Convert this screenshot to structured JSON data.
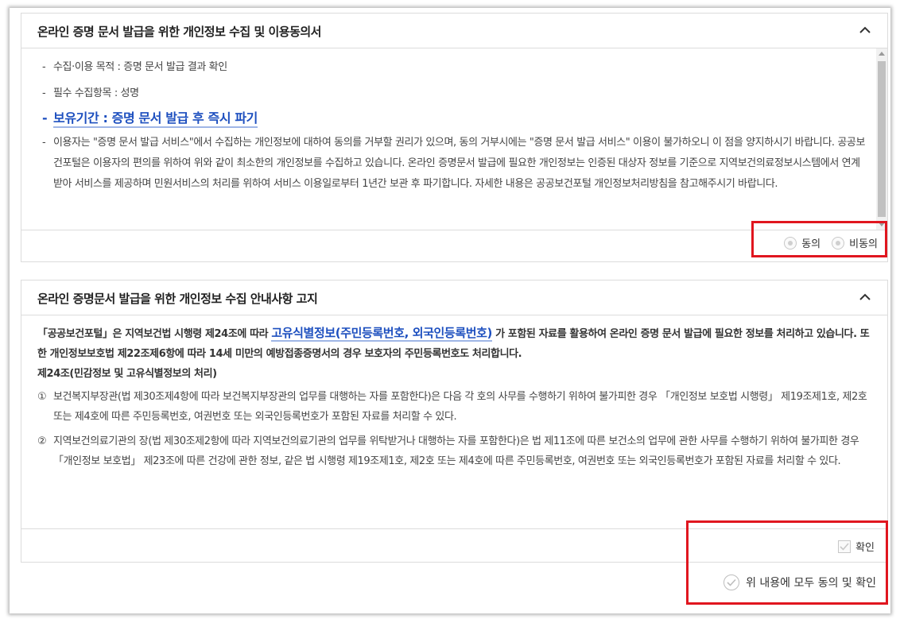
{
  "section1": {
    "title": "온라인 증명 문서 발급을 위한 개인정보 수집 및 이용동의서",
    "items": [
      "수집·이용 목적 : 증명 문서 발급 결과 확인",
      "필수 수집항목 : 성명",
      "보유기간 : 증명 문서 발급 후 즉시 파기",
      "이용자는 \"증명 문서 발급 서비스\"에서 수집하는 개인정보에 대하여 동의를 거부할 권리가 있으며, 동의 거부시에는 \"증명 문서 발급 서비스\" 이용이 불가하오니 이 점을 양지하시기 바랍니다. 공공보건포털은 이용자의 편의를 위하여 위와 같이 최소한의 개인정보를 수집하고 있습니다. 온라인 증명문서 발급에 필요한 개인정보는 인증된 대상자 정보를 기준으로 지역보건의료정보시스템에서 연계받아 서비스를 제공하며 민원서비스의 처리를 위하여 서비스 이용일로부터 1년간 보관 후 파기합니다. 자세한 내용은 공공보건포털 개인정보처리방침을 참고해주시기 바랍니다."
    ],
    "agree_label": "동의",
    "disagree_label": "비동의"
  },
  "section2": {
    "title": "온라인 증명문서 발급을 위한 개인정보 수집 안내사항 고지",
    "intro_before": "「공공보건포털」은 지역보건법 시행령 제24조에 따라",
    "intro_highlight": "고유식별정보(주민등록번호, 외국인등록번호)",
    "intro_after": "가 포함된 자료를 활용하여 온라인 증명 문서 발급에 필요한 정보를 처리하고 있습니다. 또한 개인정보보호법 제22조제6항에 따라 14세 미만의 예방접종증명서의 경우 보호자의 주민등록번호도 처리합니다.",
    "article_title": "제24조(민감정보 및 고유식별정보의 처리)",
    "items": [
      {
        "num": "①",
        "text": "보건복지부장관(법 제30조제4항에 따라 보건복지부장관의 업무를 대행하는 자를 포함한다)은 다음 각 호의 사무를 수행하기 위하여 불가피한 경우 「개인정보 보호법 시행령」 제19조제1호, 제2호 또는 제4호에 따른 주민등록번호, 여권번호 또는 외국인등록번호가 포함된 자료를 처리할 수 있다."
      },
      {
        "num": "②",
        "text": "지역보건의료기관의 장(법 제30조제2항에 따라 지역보건의료기관의 업무를 위탁받거나 대행하는 자를 포함한다)은 법 제11조에 따른 보건소의 업무에 관한 사무를 수행하기 위하여 불가피한 경우 「개인정보 보호법」 제23조에 따른 건강에 관한 정보, 같은 법 시행령 제19조제1호, 제2호 또는 제4호에 따른 주민등록번호, 여권번호 또는 외국인등록번호가 포함된 자료를 처리할 수 있다."
      }
    ],
    "confirm_label": "확인"
  },
  "agree_all_label": "위 내용에 모두 동의 및 확인",
  "colors": {
    "highlight": "#1d4fbf",
    "red_box": "#e0161f",
    "border": "#dcdcdc"
  }
}
